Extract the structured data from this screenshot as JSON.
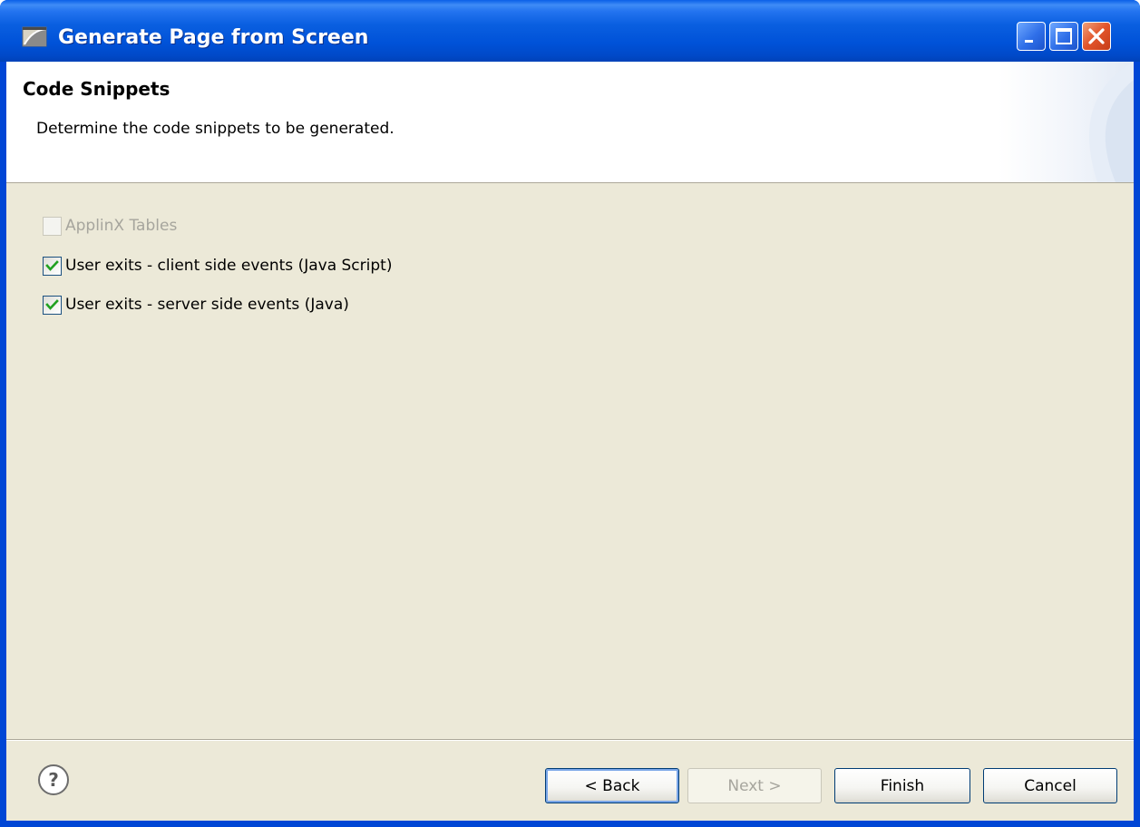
{
  "window": {
    "title": "Generate Page from Screen",
    "icon": "eclipse-wizard-icon",
    "controls": {
      "minimize_icon": "minimize-icon",
      "maximize_icon": "maximize-icon",
      "close_icon": "close-icon"
    }
  },
  "header": {
    "title": "Code Snippets",
    "description": "Determine the code snippets to be generated."
  },
  "options": [
    {
      "label": "ApplinX Tables",
      "checked": false,
      "enabled": false
    },
    {
      "label": "User exits - client side events (Java Script)",
      "checked": true,
      "enabled": true
    },
    {
      "label": "User exits - server side events (Java)",
      "checked": true,
      "enabled": true
    }
  ],
  "footer": {
    "help_icon": "help-icon",
    "back_label": "< Back",
    "next_label": "Next >",
    "finish_label": "Finish",
    "cancel_label": "Cancel"
  },
  "colors": {
    "titlebar": "#0058e6",
    "dialog_bg": "#ece9d8",
    "checkmark": "#21a121",
    "close_button": "#e2542a"
  }
}
